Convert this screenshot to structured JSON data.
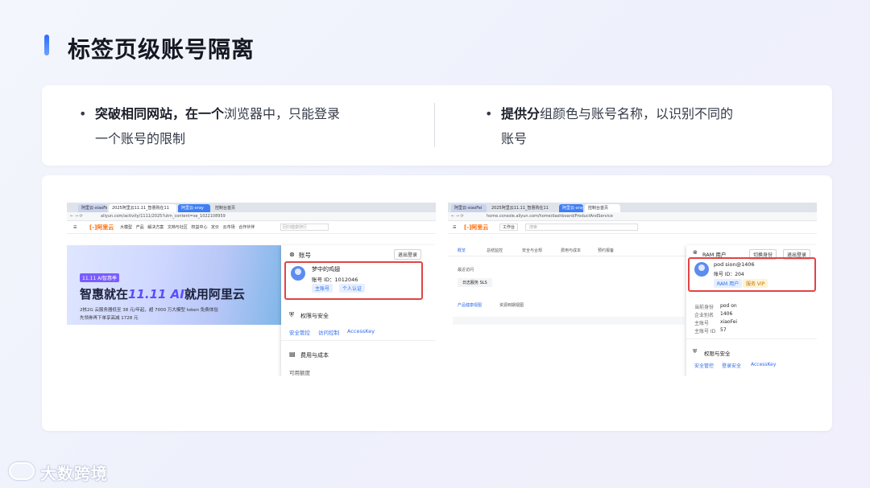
{
  "slide": {
    "title": "标签页级账号隔离",
    "bullets": [
      {
        "strong1": "突破相同网站，在一个",
        "rest1": "浏览器中，只能登录",
        "line2": "一个账号的限制"
      },
      {
        "strong1": "提供分",
        "rest1": "组颜色与账号名称，以识别不同的",
        "line2": "账号"
      }
    ]
  },
  "left_shot": {
    "tabs": [
      "阿里云-xiaoFei",
      "2025阿里云11.11_智惠购在11",
      "阿里云-xray",
      "控制台首页"
    ],
    "address": "aliyun.com/activity/1111/2025?utm_content=se_1022108959",
    "nav_items": [
      "大模型",
      "产品",
      "解决方案",
      "文档与社区",
      "权益中心",
      "定价",
      "云市场",
      "合作伙伴"
    ],
    "search_placeholder": "回归健康骑行",
    "banner_badge": "11.11 AI智惠季",
    "banner_title_a": "智惠就在",
    "banner_title_b": "11.11 AI",
    "banner_title_c": "就用阿里云",
    "banner_line1": "2核2G 云服务器低至 38 元/年起，超 7000 万大模型 token 免费体验",
    "banner_line2": "先领券再下单享高减 1728 元",
    "dropdown": {
      "section": "账号",
      "logout": "退出登录",
      "name": "梦中的鸡翅",
      "id_label": "账号 ID：1012046",
      "tag1": "主账号",
      "tag2": "个人认证",
      "perm_title": "权限与安全",
      "links": [
        "安全管控",
        "访问控制",
        "AccessKey"
      ],
      "cost_title": "费用与成本",
      "more": "可用额度"
    }
  },
  "right_shot": {
    "tabs": [
      "阿里云-xiaoFei",
      "2025阿里云11.11_智惠购在11",
      "阿里云-xray",
      "控制台首页"
    ],
    "address": "home.console.aliyun.com/home/dashboard/ProductAndService",
    "workbench": "工作台",
    "search_placeholder": "搜索",
    "tabs_row": [
      "概览",
      "总结监控",
      "安全与合规",
      "费用与成本",
      "预约报备"
    ],
    "recent": "最近访问",
    "recent_item": "日志服务 SLS",
    "sub_tabs": [
      "产品健康视图",
      "资源到期视图"
    ],
    "dropdown": {
      "header": "RAM 用户",
      "switch": "切换身份",
      "logout": "退出登录",
      "name": "pod        sion@1406",
      "id_label": "账号 ID：204",
      "tag1": "RAM 用户",
      "tag2": "服务 VIP",
      "info": [
        {
          "k": "当前身份",
          "v": "pod        on"
        },
        {
          "k": "企业别名",
          "v": "1406"
        },
        {
          "k": "主账号",
          "v": "xiaoFei"
        },
        {
          "k": "主账号 ID",
          "v": "57"
        }
      ],
      "perm_title": "权限与安全",
      "links": [
        "安全管控",
        "登录安全",
        "AccessKey"
      ]
    }
  },
  "footer": {
    "brand": "大数跨境"
  },
  "colors": {
    "accent": "#2d6bff",
    "highlight": "#e24444",
    "aliyun": "#ff6a00"
  }
}
